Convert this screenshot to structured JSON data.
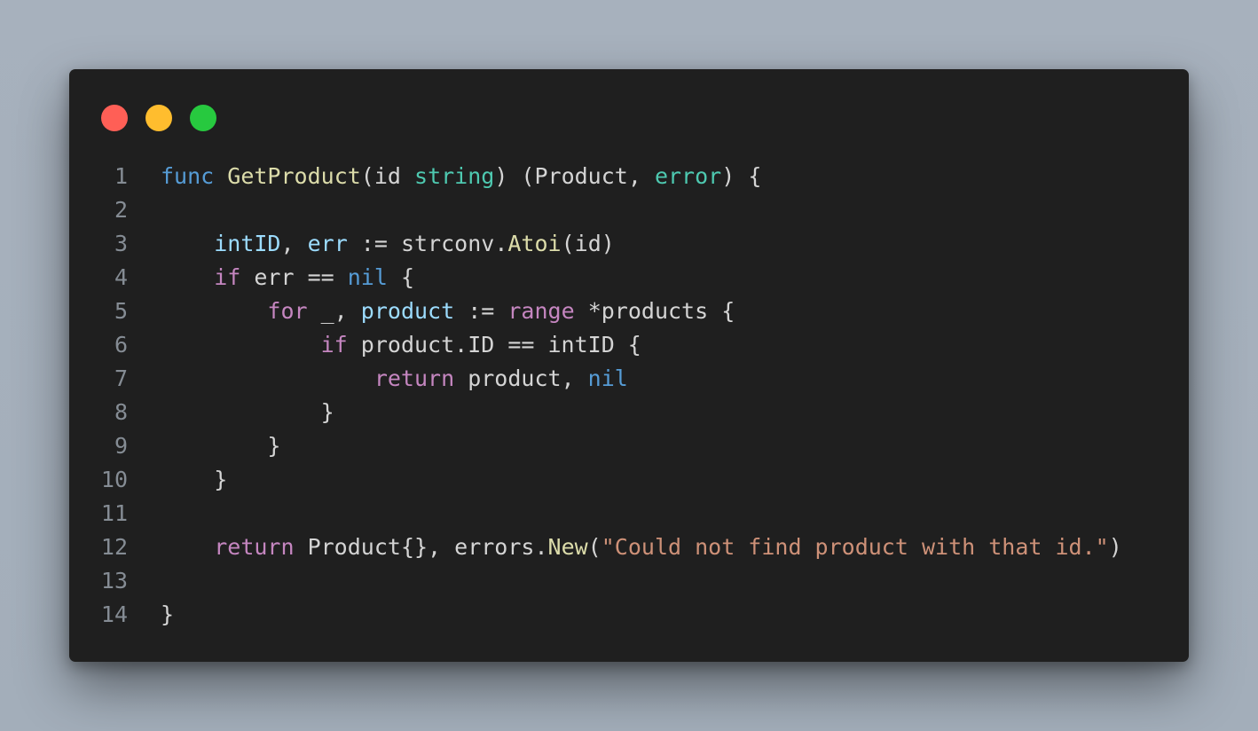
{
  "window": {
    "controls": [
      "close",
      "minimize",
      "maximize"
    ],
    "colors": {
      "background": "#1f1f1f",
      "close": "#ff5f56",
      "minimize": "#ffbd2e",
      "maximize": "#27c93f"
    }
  },
  "code": {
    "language": "go",
    "lines": [
      {
        "n": "1",
        "tokens": [
          {
            "t": "func",
            "c": "kw-blue"
          },
          {
            "t": " "
          },
          {
            "t": "GetProduct",
            "c": "fn"
          },
          {
            "t": "(id "
          },
          {
            "t": "string",
            "c": "type"
          },
          {
            "t": ") (Product, "
          },
          {
            "t": "error",
            "c": "type"
          },
          {
            "t": ") {"
          }
        ]
      },
      {
        "n": "2",
        "tokens": []
      },
      {
        "n": "3",
        "tokens": [
          {
            "t": "    "
          },
          {
            "t": "intID",
            "c": "var"
          },
          {
            "t": ", "
          },
          {
            "t": "err",
            "c": "var"
          },
          {
            "t": " := strconv."
          },
          {
            "t": "Atoi",
            "c": "fn"
          },
          {
            "t": "(id)"
          }
        ]
      },
      {
        "n": "4",
        "tokens": [
          {
            "t": "    "
          },
          {
            "t": "if",
            "c": "kw-purple"
          },
          {
            "t": " err == "
          },
          {
            "t": "nil",
            "c": "kw-blue"
          },
          {
            "t": " {"
          }
        ]
      },
      {
        "n": "5",
        "tokens": [
          {
            "t": "        "
          },
          {
            "t": "for",
            "c": "kw-purple"
          },
          {
            "t": " _, "
          },
          {
            "t": "product",
            "c": "var"
          },
          {
            "t": " := "
          },
          {
            "t": "range",
            "c": "kw-purple"
          },
          {
            "t": " *products {"
          }
        ]
      },
      {
        "n": "6",
        "tokens": [
          {
            "t": "            "
          },
          {
            "t": "if",
            "c": "kw-purple"
          },
          {
            "t": " product.ID == intID {"
          }
        ]
      },
      {
        "n": "7",
        "tokens": [
          {
            "t": "                "
          },
          {
            "t": "return",
            "c": "kw-purple"
          },
          {
            "t": " product, "
          },
          {
            "t": "nil",
            "c": "kw-blue"
          }
        ]
      },
      {
        "n": "8",
        "tokens": [
          {
            "t": "            }"
          }
        ]
      },
      {
        "n": "9",
        "tokens": [
          {
            "t": "        }"
          }
        ]
      },
      {
        "n": "10",
        "tokens": [
          {
            "t": "    }"
          }
        ]
      },
      {
        "n": "11",
        "tokens": []
      },
      {
        "n": "12",
        "tokens": [
          {
            "t": "    "
          },
          {
            "t": "return",
            "c": "kw-purple"
          },
          {
            "t": " Product{}, errors."
          },
          {
            "t": "New",
            "c": "fn"
          },
          {
            "t": "("
          },
          {
            "t": "\"Could not find product with that id.\"",
            "c": "str"
          },
          {
            "t": ")"
          }
        ]
      },
      {
        "n": "13",
        "tokens": []
      },
      {
        "n": "14",
        "tokens": [
          {
            "t": "}"
          }
        ]
      }
    ]
  }
}
